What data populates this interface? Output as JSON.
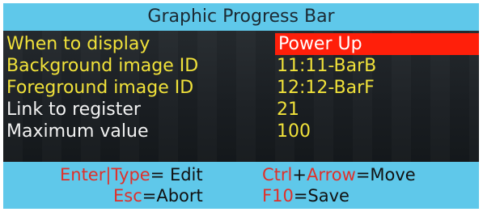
{
  "title": "Graphic Progress Bar",
  "rows": [
    {
      "label": "When to display",
      "value": "Power Up",
      "selected": true
    },
    {
      "label": "Background image ID",
      "value": "11:11-BarB"
    },
    {
      "label": "Foreground image ID",
      "value": "12:12-BarF"
    },
    {
      "label": "Link to register",
      "value": "21"
    },
    {
      "label": "Maximum value",
      "value": "100"
    }
  ],
  "help": {
    "enter_key": "Enter",
    "separator": "|",
    "type_key": "Type",
    "edit_text": "= Edit",
    "ctrl_key": "Ctrl",
    "plus": "+",
    "arrow_key": "Arrow",
    "move_text": "=Move",
    "esc_key": "Esc",
    "abort_text": "=Abort",
    "f10_key": "F10",
    "save_text": "=Save"
  },
  "colors": {
    "title_bar": "#5fc8ea",
    "panel_bg": "#14171a",
    "label_yellow": "#f1e23a",
    "label_white": "#f2f2f2",
    "selected_bg": "#ff1f0a",
    "key_red": "#e0302a"
  }
}
